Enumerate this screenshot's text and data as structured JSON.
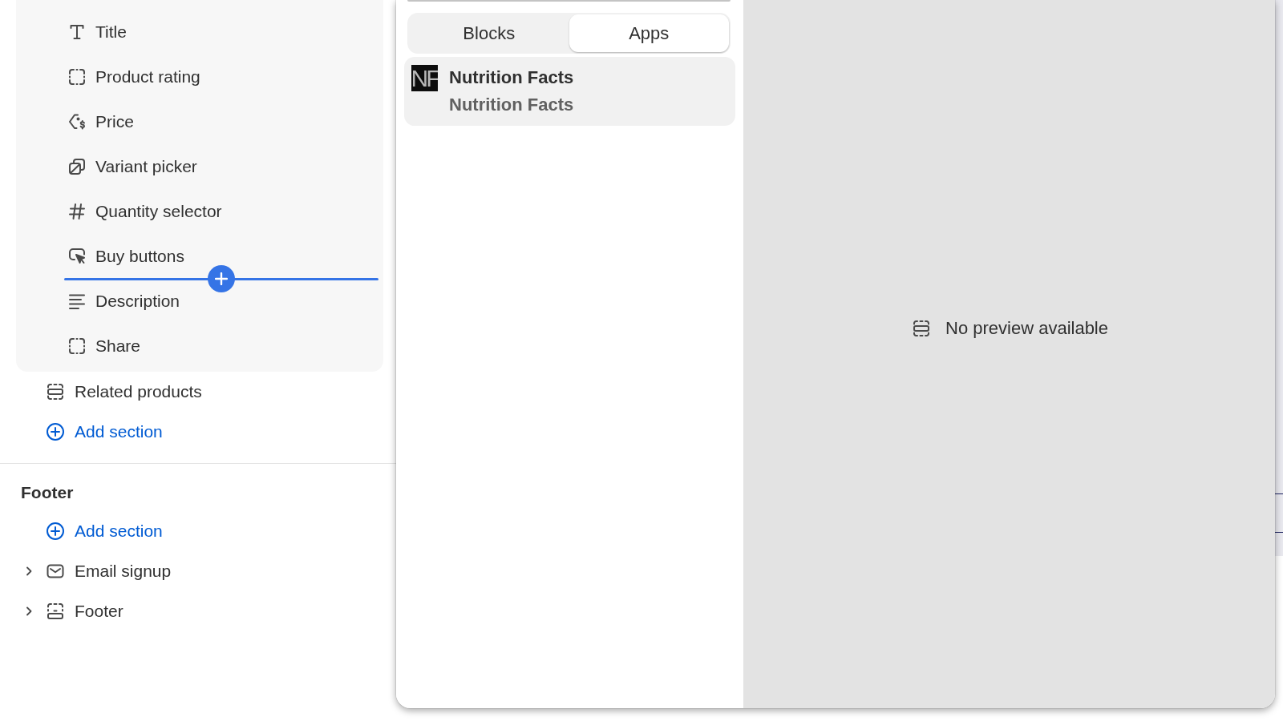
{
  "sidebar": {
    "blocks": [
      {
        "kind": "block",
        "label": "Title"
      },
      {
        "kind": "block",
        "label": "Product rating"
      },
      {
        "kind": "block",
        "label": "Price"
      },
      {
        "kind": "block",
        "label": "Variant picker"
      },
      {
        "kind": "block",
        "label": "Quantity selector"
      },
      {
        "kind": "block",
        "label": "Buy buttons"
      },
      {
        "kind": "insert-marker"
      },
      {
        "kind": "block",
        "label": "Description"
      },
      {
        "kind": "block",
        "label": "Share"
      }
    ],
    "template_sections": [
      {
        "kind": "section",
        "label": "Related products"
      },
      {
        "kind": "add",
        "label": "Add section"
      }
    ],
    "footer_group": {
      "heading": "Footer",
      "items": [
        {
          "kind": "add",
          "label": "Add section"
        },
        {
          "kind": "expandable",
          "label": "Email signup",
          "expanded": false
        },
        {
          "kind": "expandable",
          "label": "Footer",
          "expanded": false
        }
      ]
    }
  },
  "block_picker": {
    "tabs": [
      {
        "label": "Blocks",
        "selected": false
      },
      {
        "label": "Apps",
        "selected": true
      }
    ],
    "apps": [
      {
        "logo": "NF",
        "name": "Nutrition Facts",
        "developer": "Nutrition Facts"
      }
    ],
    "preview": {
      "message": "No preview available"
    }
  }
}
